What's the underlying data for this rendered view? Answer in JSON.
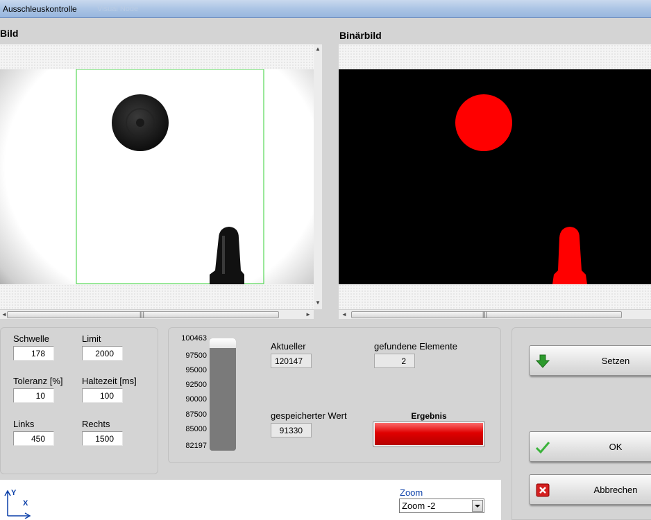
{
  "window": {
    "title": "Ausschleuskontrolle",
    "ghost_title": "Visual Node"
  },
  "left_panel": {
    "label": "Bild"
  },
  "right_panel": {
    "label": "Binärbild"
  },
  "params": {
    "schwelle": {
      "label": "Schwelle",
      "value": "178"
    },
    "limit": {
      "label": "Limit",
      "value": "2000"
    },
    "toleranz": {
      "label": "Toleranz [%]",
      "value": "10"
    },
    "haltezeit": {
      "label": "Haltezeit [ms]",
      "value": "100"
    },
    "links": {
      "label": "Links",
      "value": "450"
    },
    "rechts": {
      "label": "Rechts",
      "value": "1500"
    }
  },
  "meter": {
    "scale": [
      "100463",
      "97500",
      "95000",
      "92500",
      "90000",
      "87500",
      "85000",
      "82197"
    ],
    "fill_fraction": 1.0
  },
  "readouts": {
    "aktueller": {
      "label": "Aktueller",
      "value": "120147"
    },
    "gespeichert": {
      "label": "gespeicherter Wert",
      "value": "91330"
    },
    "elemente": {
      "label": "gefundene Elemente",
      "value": "2"
    },
    "ergebnis": {
      "label": "Ergebnis",
      "color": "#e00000"
    }
  },
  "buttons": {
    "setzen": "Setzen",
    "ok": "OK",
    "abbrechen": "Abbrechen"
  },
  "axis": {
    "y": "Y",
    "x": "X"
  },
  "zoom": {
    "label": "Zoom",
    "value": "Zoom -2"
  },
  "colors": {
    "accent": "#0a3fa8",
    "binary_fg": "#ff0000",
    "roi": "#35d035"
  }
}
